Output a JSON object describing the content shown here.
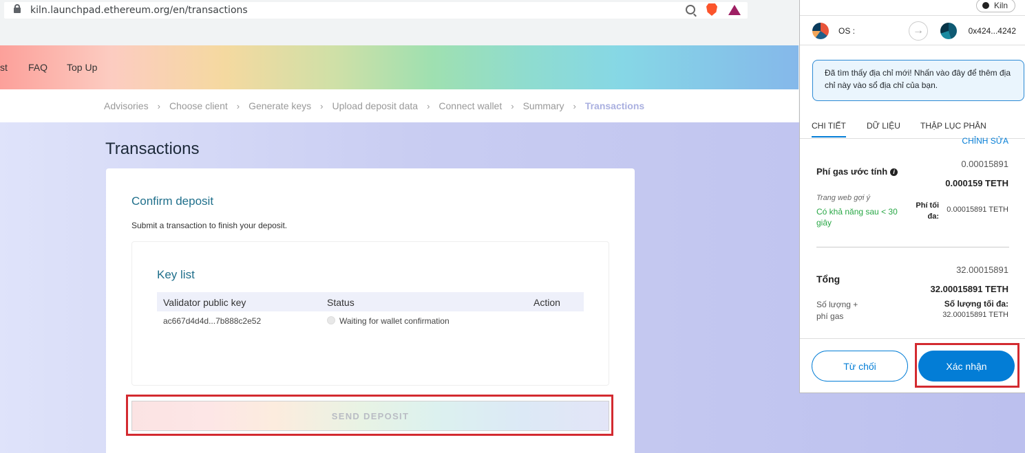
{
  "browser": {
    "url": "kiln.launchpad.ethereum.org/en/transactions"
  },
  "header": {
    "nav_partial": "st",
    "nav_faq": "FAQ",
    "nav_topup": "Top Up"
  },
  "breadcrumb": {
    "items": [
      "Advisories",
      "Choose client",
      "Generate keys",
      "Upload deposit data",
      "Connect wallet",
      "Summary",
      "Transactions"
    ]
  },
  "page": {
    "title": "Transactions",
    "confirm_title": "Confirm deposit",
    "confirm_subtitle": "Submit a transaction to finish your deposit.",
    "key_list_title": "Key list",
    "table_headers": [
      "Validator public key",
      "Status",
      "Action"
    ],
    "rows": [
      {
        "pubkey": "ac667d4d4d...7b888c2e52",
        "status": "Waiting for wallet confirmation"
      }
    ],
    "send_button": "SEND DEPOSIT"
  },
  "metamask": {
    "network": "Kiln",
    "from_account": "OS :",
    "to_account": "0x424...4242",
    "notice": "Đã tìm thấy địa chỉ mới! Nhấn vào đây để thêm địa chỉ này vào sổ địa chỉ của bạn.",
    "tabs": [
      "CHI TIẾT",
      "DỮ LIỆU",
      "THẬP LỤC PHÂN"
    ],
    "edit_link": "CHỈNH SỬA",
    "gas_label": "Phí gas ước tính",
    "gas_fee_small": "0.00015891",
    "gas_fee_big": "0.000159 TETH",
    "site_suggested": "Trang web gợi ý",
    "likely_time": "Có khả năng sau < 30 giây",
    "max_fee_label": "Phí tối đa:",
    "max_fee_value": "0.00015891 TETH",
    "total_label": "Tổng",
    "total_small": "32.00015891",
    "total_big": "32.00015891 TETH",
    "amount_gas_label": "Số lượng + phí gas",
    "max_total_label": "Số lượng tối đa:",
    "max_total_value": "32.00015891 TETH",
    "reject_button": "Từ chối",
    "confirm_button": "Xác nhận"
  },
  "colors": {
    "metamask_blue": "#037dd6",
    "highlight_red": "#d32a30",
    "title_teal": "#1f6f8b"
  }
}
